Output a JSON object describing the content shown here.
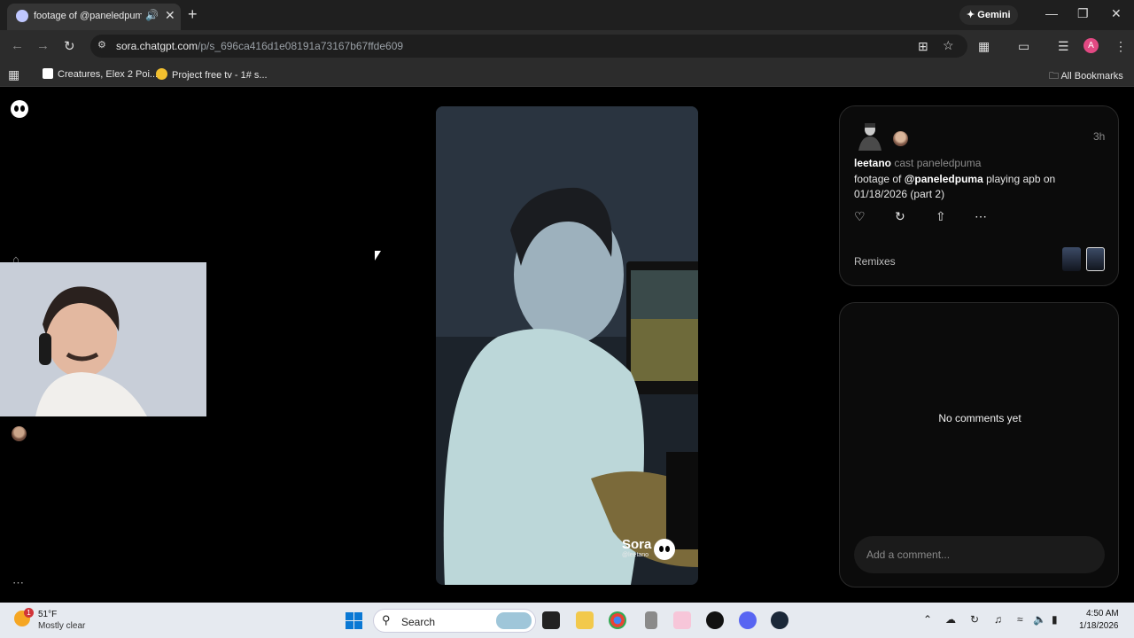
{
  "browser": {
    "tab_title": "footage of @paneledpuma",
    "new_tab": "+",
    "gemini_label": "Gemini",
    "url_host": "sora.chatgpt.com",
    "url_path": "/p/s_696ca416d1e08191a73167b67ffde609",
    "profile_initial": "A",
    "bookmarks": [
      "Creatures, Elex 2 Poi...",
      "Project free tv - 1# s..."
    ],
    "all_bookmarks": "All Bookmarks"
  },
  "video": {
    "watermark_brand": "Sora",
    "watermark_user": "@leetano"
  },
  "post": {
    "author": "leetano",
    "cast_label": "cast paneledpuma",
    "caption_prefix": "footage of ",
    "caption_mention": "@paneledpuma",
    "caption_suffix": " playing apb on 01/18/2026 (part 2)",
    "time_ago": "3h",
    "remixes_label": "Remixes"
  },
  "comments": {
    "empty_text": "No comments yet",
    "input_placeholder": "Add a comment..."
  },
  "taskbar": {
    "weather_temp": "51°F",
    "weather_condition": "Mostly clear",
    "weather_badge": "1",
    "search_label": "Search",
    "time": "4:50 AM",
    "date": "1/18/2026"
  },
  "colors": {
    "accent_profile": "#e24983",
    "windows_blue": "#0a78d4",
    "page_background": "#000000"
  },
  "icons": {
    "close": "close-icon",
    "speaker": "speaker-icon",
    "back": "back-arrow-icon",
    "forward": "forward-arrow-icon",
    "reload": "reload-icon",
    "like": "heart-icon",
    "remix": "remix-icon",
    "share": "share-icon",
    "more": "more-icon"
  }
}
